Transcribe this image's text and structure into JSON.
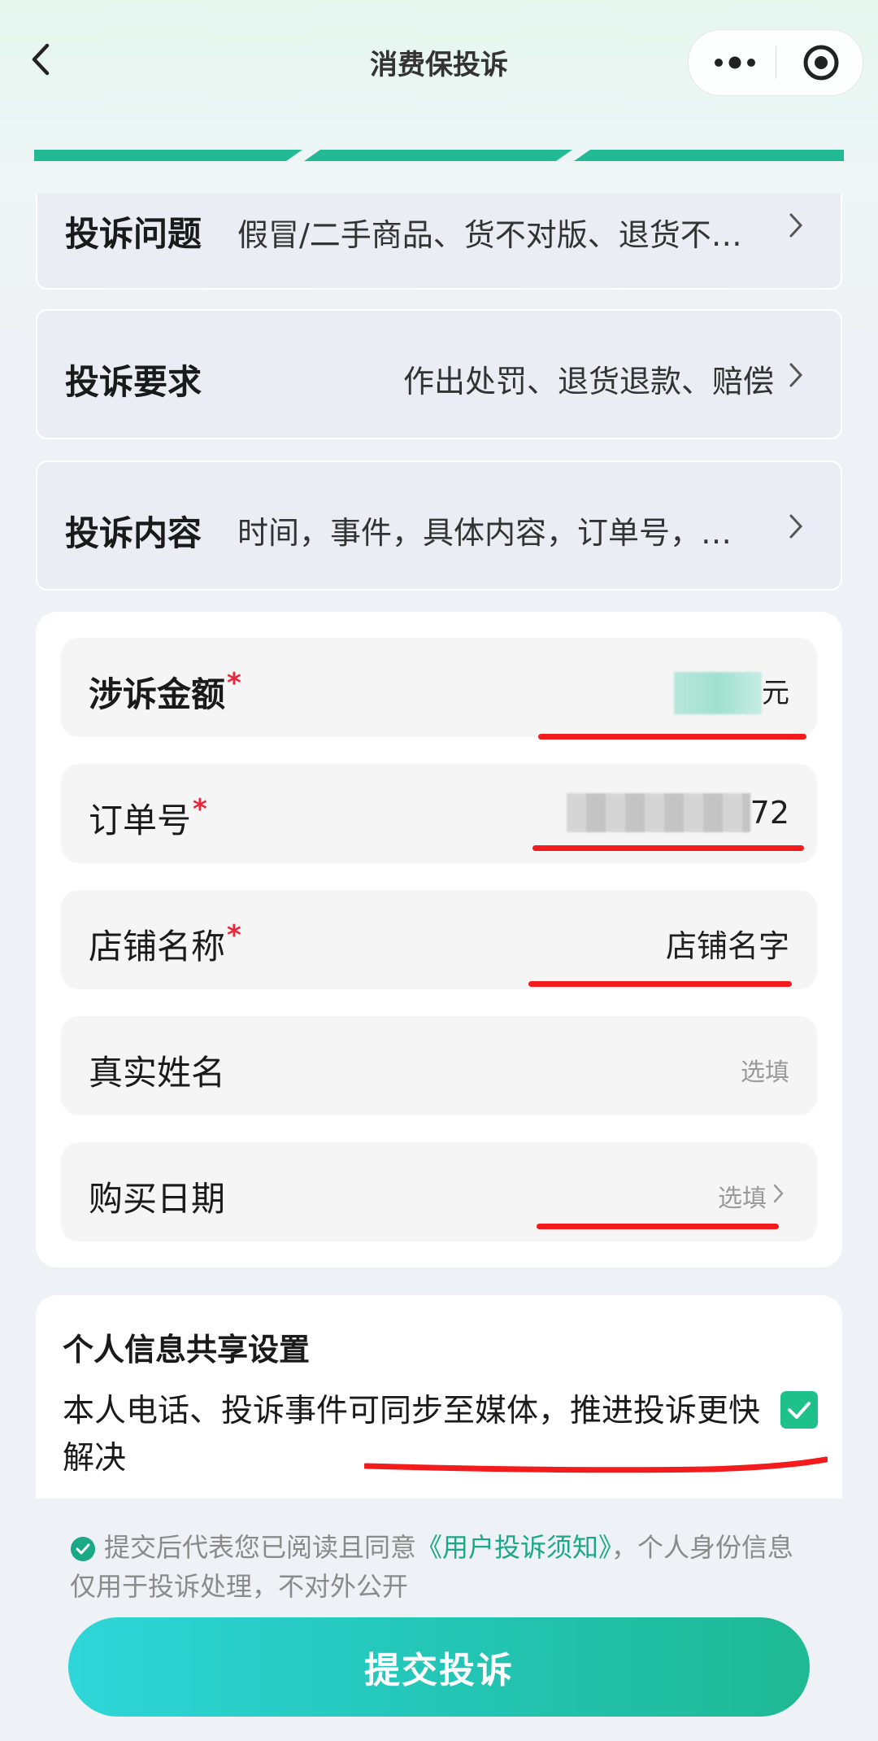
{
  "header": {
    "title": "消费保投诉"
  },
  "complaint": {
    "issue_label": "投诉问题",
    "issue_value": "假冒/二手商品、货不对版、退货不…",
    "demand_label": "投诉要求",
    "demand_value": "作出处罚、退货退款、赔偿",
    "content_label": "投诉内容",
    "content_value": "时间，事件，具体内容，订单号，…"
  },
  "form": {
    "amount_label": "涉诉金额",
    "amount_unit": "元",
    "order_label": "订单号",
    "order_suffix": "72",
    "shop_label": "店铺名称",
    "shop_value": "店铺名字",
    "name_label": "真实姓名",
    "name_placeholder": "选填",
    "date_label": "购买日期",
    "date_placeholder": "选填",
    "required_mark": "*"
  },
  "sharing": {
    "title": "个人信息共享设置",
    "text": "本人电话、投诉事件可同步至媒体，推进投诉更快解决",
    "checked": true
  },
  "agreement": {
    "prefix": "提交后代表您已阅读且同意",
    "link": "《用户投诉须知》",
    "suffix": "，个人身份信息仅用于投诉处理，不对外公开"
  },
  "submit_label": "提交投诉",
  "colors": {
    "accent": "#1fc18a",
    "required": "#e8283a",
    "link": "#1aa886"
  }
}
